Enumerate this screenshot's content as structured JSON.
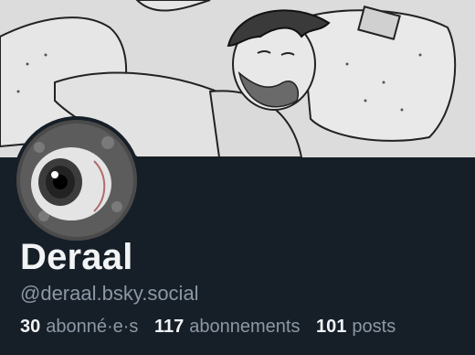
{
  "profile": {
    "display_name": "Deraal",
    "handle": "@deraal.bsky.social",
    "stats": [
      {
        "value": "30",
        "label": "abonné·e·s"
      },
      {
        "value": "117",
        "label": "abonnements"
      },
      {
        "value": "101",
        "label": "posts"
      }
    ]
  },
  "banner": {
    "icon": "sketch-sleeping-man-banner"
  },
  "avatar": {
    "icon": "eyeball-avatar"
  },
  "colors": {
    "background": "#161e27",
    "name": "#f1f3f5",
    "muted": "#8b98a5"
  }
}
